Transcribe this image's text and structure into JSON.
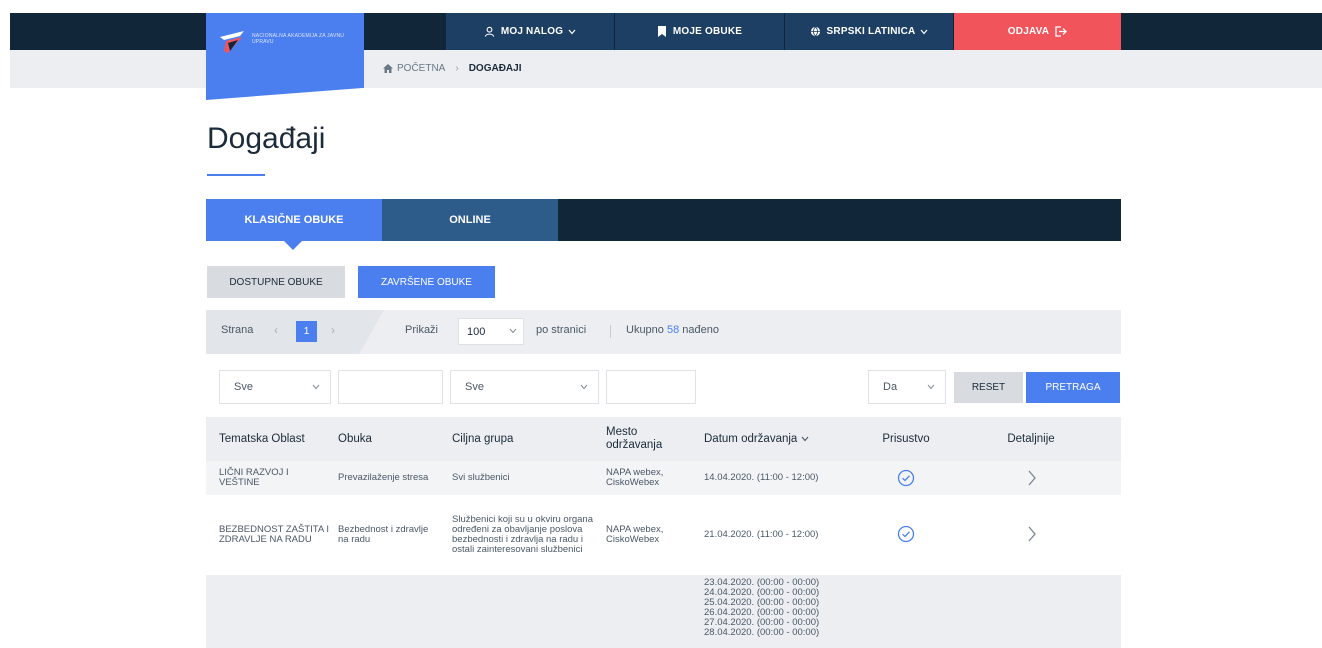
{
  "header": {
    "logo_text": "Nacionalna akademija za javnu upravu",
    "nav": {
      "account_label": "MOJ NALOG",
      "trainings_label": "MOJE OBUKE",
      "language_label": "SRPSKI LATINICA",
      "logout_label": "ODJAVA"
    },
    "colors": {
      "dark": "#12263a",
      "nav": "#1d3f63",
      "accent": "#4b7ff0",
      "logout": "#f2545b"
    }
  },
  "breadcrumb": {
    "home_label": "POČETNA",
    "current_label": "DOGAĐAJI"
  },
  "page": {
    "title": "Događaji"
  },
  "tabs": [
    {
      "label": "KLASIČNE OBUKE",
      "active": true
    },
    {
      "label": "ONLINE",
      "active": false
    }
  ],
  "subtabs": {
    "available_label": "DOSTUPNE OBUKE",
    "completed_label": "ZAVRŠENE OBUKE"
  },
  "pager": {
    "page_label": "Strana",
    "current_page": "1",
    "show_label": "Prikaži",
    "per_page_value": "100",
    "per_page_suffix": "po stranici",
    "total_prefix": "Ukupno",
    "total_count": "58",
    "total_suffix": "nađeno"
  },
  "filters": {
    "area_value": "Sve",
    "training_value": "",
    "target_value": "Sve",
    "location_value": "",
    "attendance_value": "Da",
    "reset_label": "RESET",
    "search_label": "PRETRAGA"
  },
  "table": {
    "headers": {
      "area": "Tematska Oblast",
      "training": "Obuka",
      "target": "Ciljna grupa",
      "location": "Mesto održavanja",
      "date": "Datum održavanja",
      "attendance": "Prisustvo",
      "details": "Detaljnije"
    },
    "rows": [
      {
        "area": "LIČNI RAZVOJ I VEŠTINE",
        "training": "Prevazilaženje stresa",
        "target": "Svi službenici",
        "location": "NAPA webex, CiskoWebex",
        "date": "14.04.2020. (11:00 - 12:00)"
      },
      {
        "area": "BEZBEDNOST ZAŠTITA I ZDRAVLJE NA RADU",
        "training": "Bezbednost i zdravlje na radu",
        "target": "Službenici koji su u okviru organa određeni za obavljanje poslova bezbednosti i zdravlja na radu i ostali zainteresovani službenici",
        "location": "NAPA webex, CiskoWebex",
        "date": "21.04.2020. (11:00 - 12:00)"
      },
      {
        "dates": "23.04.2020. (00:00 - 00:00)\n24.04.2020. (00:00 - 00:00)\n25.04.2020. (00:00 - 00:00)\n26.04.2020. (00:00 - 00:00)\n27.04.2020. (00:00 - 00:00)\n28.04.2020. (00:00 - 00:00)"
      }
    ]
  }
}
